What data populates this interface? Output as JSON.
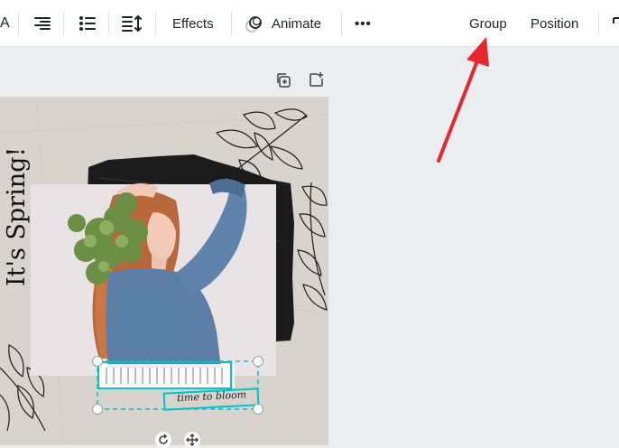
{
  "toolbar": {
    "font_fragment": "A",
    "effects_label": "Effects",
    "animate_label": "Animate",
    "more_label": "•••",
    "group_label": "Group",
    "position_label": "Position"
  },
  "design": {
    "heading_text": "It's Spring!",
    "tagline_text": "time to bloom"
  },
  "colors": {
    "selection": "#00c4cc",
    "arrow": "#e8262c",
    "page_bg": "#d9d3ce"
  }
}
